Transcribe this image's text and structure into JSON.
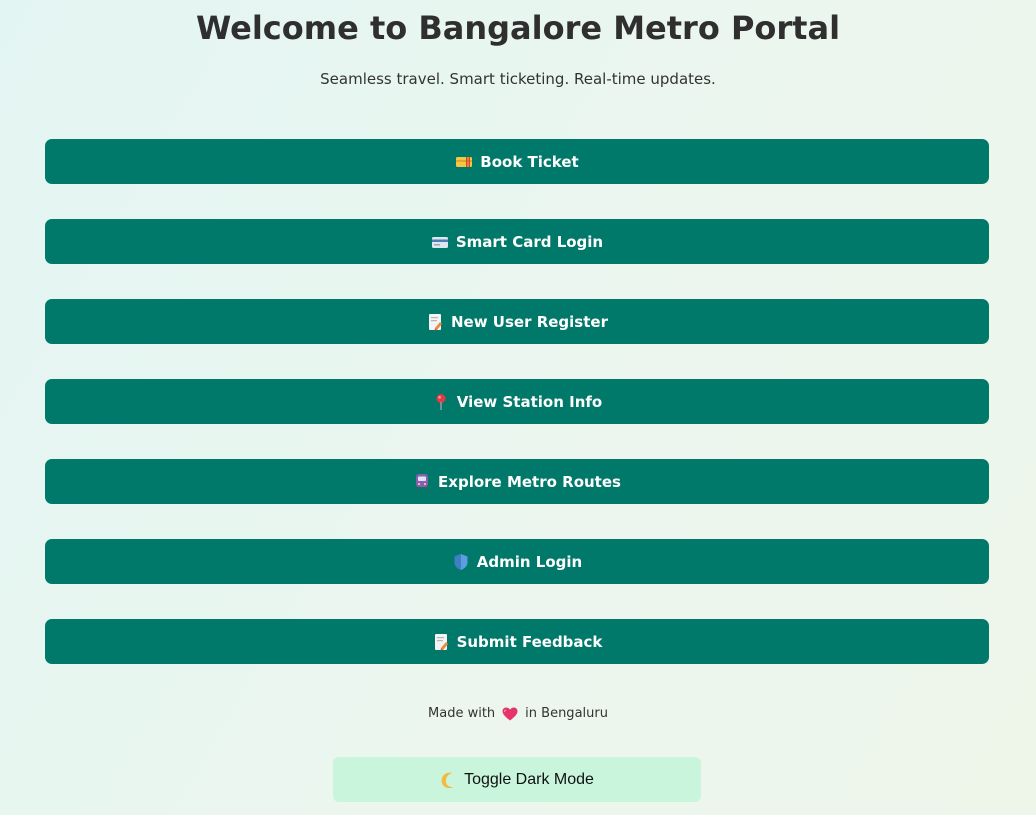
{
  "header": {
    "title": "Welcome to Bangalore Metro Portal",
    "subtitle": "Seamless travel. Smart ticketing. Real-time updates."
  },
  "menu": {
    "items": [
      {
        "label": "Book Ticket",
        "icon": "ticket-icon"
      },
      {
        "label": "Smart Card Login",
        "icon": "credit-card-icon"
      },
      {
        "label": "New User Register",
        "icon": "memo-icon"
      },
      {
        "label": "View Station Info",
        "icon": "map-pin-icon"
      },
      {
        "label": "Explore Metro Routes",
        "icon": "metro-train-icon"
      },
      {
        "label": "Admin Login",
        "icon": "shield-icon"
      },
      {
        "label": "Submit Feedback",
        "icon": "memo-icon"
      }
    ]
  },
  "footer": {
    "made_with": "Made with",
    "location": "in Bengaluru",
    "icon": "heart-icon"
  },
  "toggle": {
    "label": "Toggle Dark Mode",
    "icon": "crescent-moon-icon"
  },
  "colors": {
    "button_bg": "#00796b",
    "button_text": "#ffffff",
    "toggle_bg": "#c8f5dc",
    "heading_text": "#2f2f2f"
  }
}
